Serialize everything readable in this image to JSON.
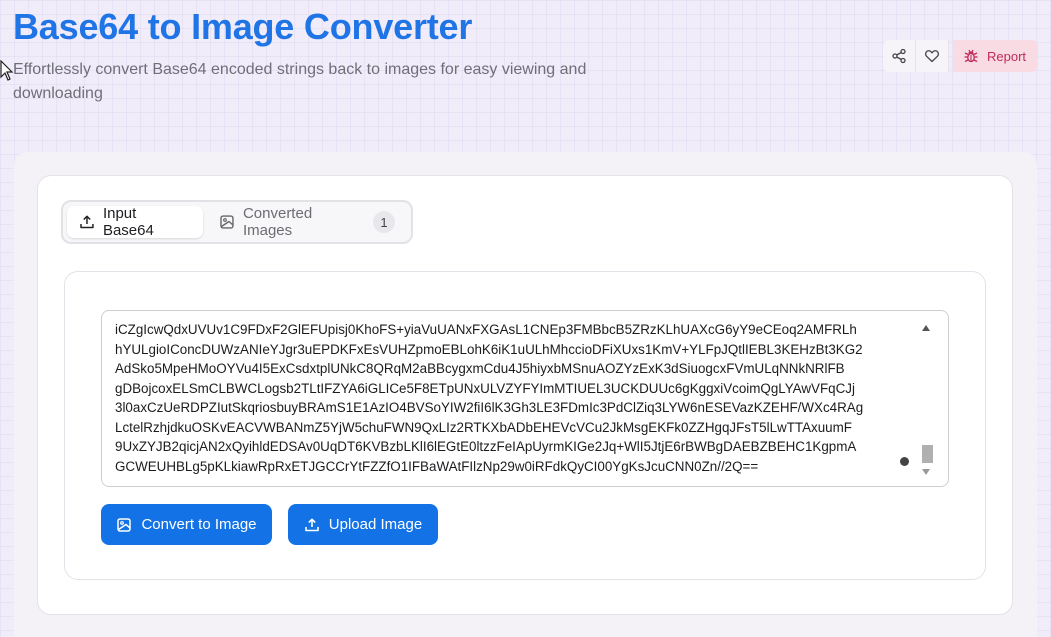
{
  "header": {
    "title": "Base64 to Image Converter",
    "subtitle": "Effortlessly convert Base64 encoded strings back to images for easy viewing and downloading"
  },
  "actions": {
    "share_icon": "share-icon",
    "favorite_icon": "heart-icon",
    "report_icon": "bug-icon",
    "report_label": "Report"
  },
  "tabs": [
    {
      "label": "Input Base64",
      "icon": "upload-icon",
      "active": true
    },
    {
      "label": "Converted Images",
      "icon": "image-icon",
      "count": "1",
      "active": false
    }
  ],
  "input": {
    "value": "iCZgIcwQdxUVUv1C9FDxF2GlEFUpisj0KhoFS+yiaVuUANxFXGAsL1CNEp3FMBbcB5ZRzKLhUAXcG6yY9eCEoq2AMFRLh\nhYULgioIConcDUWzANIeYJgr3uEPDKFxEsVUHZpmoEBLohK6iK1uULhMhccioDFiXUxs1KmV+YLFpJQtlIEBL3KEHzBt3KG2\nAdSko5MpeHMoOYVu4I5ExCsdxtplUNkC8QRqM2aBBcygxmCdu4J5hiyxbMSnuAOZYzExK3dSiuogcxFVmULqNNkNRlFB\ngDBojcoxELSmCLBWCLogsb2TLtIFZYA6iGLICe5F8ETpUNxULVZYFYImMTIUEL3UCKDUUc6gKggxiVcoimQgLYAwVFqCJj\n3l0axCzUeRDPZIutSkqriosbuyBRAmS1E1AzIO4BVSoYIW2fiI6lK3Gh3LE3FDmIc3PdClZiq3LYW6nESEVazKZEHF/WXc4RAg\nLctelRzhjdkuOSKvEACVWBANmZ5YjW5chuFWN9QxLIz2RTKXbADbEHEVcVCu2JkMsgEKFk0ZZHgqJFsT5lLwTTAxuumF\n9UxZYJB2qicjAN2xQyihldEDSAv0UqDT6KVBzbLKlI6lEGtE0ltzzFeIApUyrmKIGe2Jq+WlI5JtjE6rBWBgDAEBZBEHC1KgpmA\nGCWEUHBLg5pKLkiawRpRxETJGCCrYtFZZfO1IFBaWAtFIlzNp29w0iRFdkQyCI00YgKsJcuCNN0Zn//2Q=="
  },
  "buttons": {
    "convert_label": "Convert to Image",
    "convert_icon": "image-icon",
    "upload_label": "Upload Image",
    "upload_icon": "upload-icon"
  },
  "colors": {
    "accent": "#1373e6",
    "title": "#1f74e6",
    "report_bg": "#f9dbe4",
    "report_text": "#c02a5e"
  }
}
